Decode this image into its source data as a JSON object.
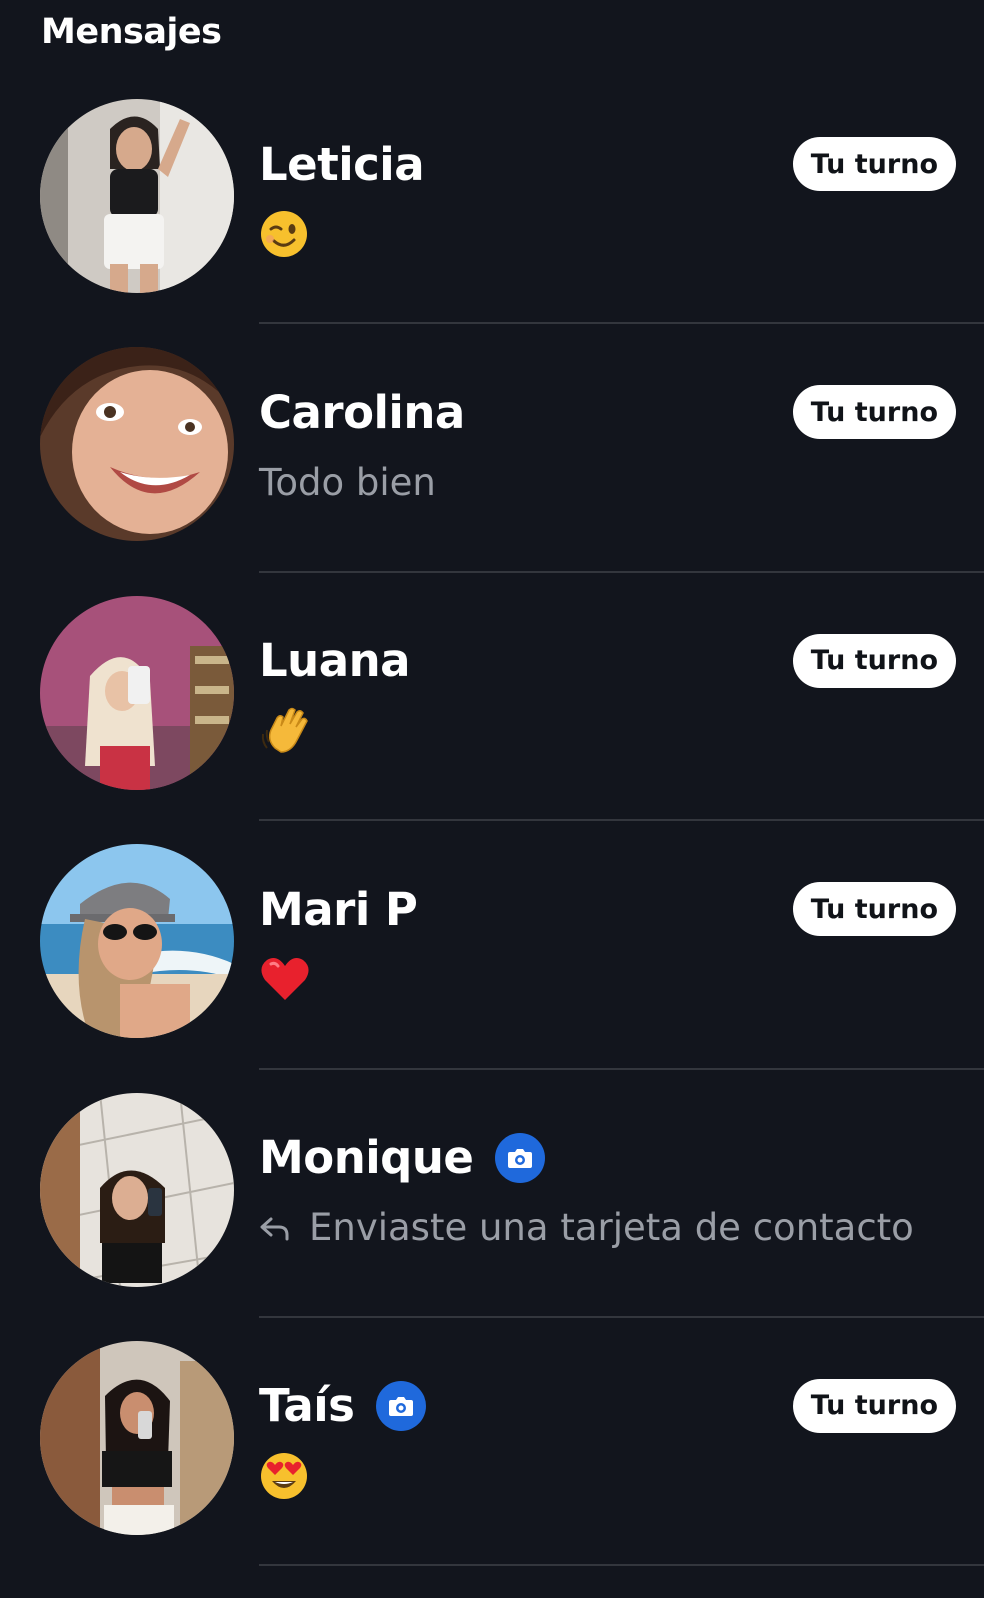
{
  "header": {
    "title": "Mensajes"
  },
  "conversations": [
    {
      "name": "Leticia",
      "has_photo_badge": false,
      "preview_emoji": "winking-face",
      "preview_text": "",
      "badge": "Tu turno"
    },
    {
      "name": "Carolina",
      "has_photo_badge": false,
      "preview_emoji": "",
      "preview_text": "Todo bien",
      "badge": "Tu turno"
    },
    {
      "name": "Luana",
      "has_photo_badge": false,
      "preview_emoji": "waving-hand",
      "preview_text": "",
      "badge": "Tu turno"
    },
    {
      "name": "Mari P",
      "has_photo_badge": false,
      "preview_emoji": "red-heart",
      "preview_text": "",
      "badge": "Tu turno"
    },
    {
      "name": "Monique",
      "has_photo_badge": true,
      "preview_emoji": "",
      "preview_text": "Enviaste una tarjeta de contacto",
      "badge": ""
    },
    {
      "name": "Taís",
      "has_photo_badge": true,
      "preview_emoji": "heart-eyes-face",
      "preview_text": "",
      "badge": "Tu turno"
    }
  ],
  "colors": {
    "background": "#12151d",
    "divider": "#33363d",
    "photo_badge": "#1f69dc",
    "muted_text": "#9a9ea6",
    "badge_bg": "#ffffff"
  }
}
